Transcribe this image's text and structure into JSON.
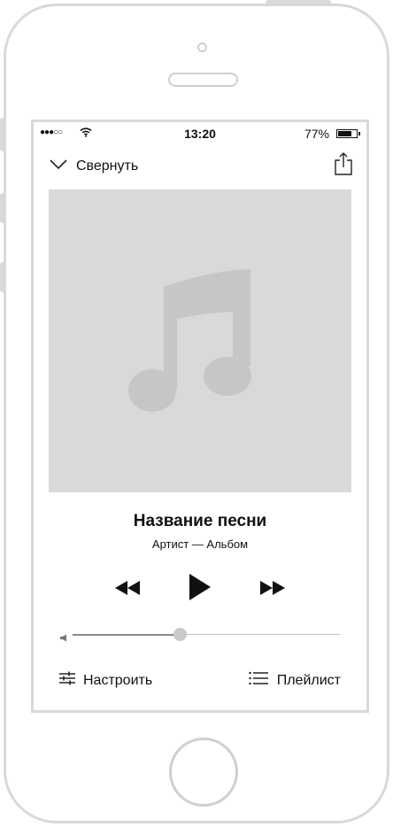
{
  "status_bar": {
    "signal": "●●●○○",
    "time": "13:20",
    "battery_percent": "77%",
    "battery_level": 0.77
  },
  "header": {
    "collapse_label": "Свернуть",
    "collapse_icon": "chevron-down-icon",
    "share_icon": "share-icon"
  },
  "album_art": {
    "placeholder_icon": "music-note-icon"
  },
  "track": {
    "title": "Название песни",
    "subtitle": "Артист — Альбом"
  },
  "controls": {
    "previous_icon": "rewind-icon",
    "play_icon": "play-icon",
    "next_icon": "fast-forward-icon"
  },
  "volume": {
    "level": 0.4
  },
  "bottom_bar": {
    "settings_label": "Настроить",
    "playlist_label": "Плейлист"
  }
}
